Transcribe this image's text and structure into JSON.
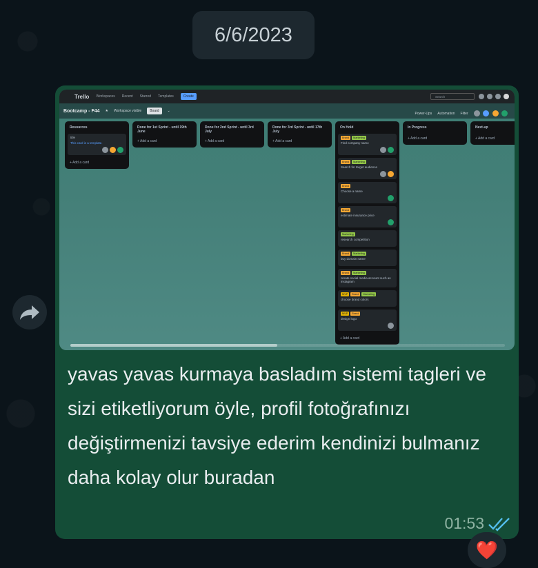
{
  "date_separator": "6/6/2023",
  "message": {
    "text": "yavas yavas kurmaya basladım sistemi tagleri ve sizi etiketliyorum öyle, profil fotoğrafınızı değiştirmenizi tavsiye ederim kendinizi bulmanız daha kolay olur buradan",
    "time": "01:53",
    "reaction": "❤️"
  },
  "trello": {
    "logo": "Trello",
    "menu": [
      "Workspaces",
      "Recent",
      "Starred",
      "Templates"
    ],
    "create": "Create",
    "search_placeholder": "Search",
    "board_name": "Bootcamp - F44",
    "visibility": "Workspace visible",
    "view": "Board",
    "tools": [
      "Power-Ups",
      "Automation",
      "Filter"
    ],
    "add_card": "+ Add a card",
    "lists": [
      {
        "title": "Resources",
        "cards": [
          {
            "title": "title",
            "sub": "This card is a template."
          }
        ]
      },
      {
        "title": "Done for 1st Sprint - until 19th June",
        "cards": []
      },
      {
        "title": "Done for 2nd Sprint - until 3rd July",
        "cards": []
      },
      {
        "title": "Done for 3rd Sprint - until 17th July",
        "cards": []
      },
      {
        "title": "On Hold",
        "cards": [
          {
            "labels": [
              "Brand",
              "Marketing"
            ],
            "title": "Find company name"
          },
          {
            "labels": [
              "Brand",
              "Marketing"
            ],
            "title": "Search for target audience"
          },
          {
            "labels": [
              "Brand"
            ],
            "title": "Choose a name"
          },
          {
            "labels": [
              "Brand"
            ],
            "title": "estimate insurance price"
          },
          {
            "labels": [
              "Marketing"
            ],
            "title": "research competition"
          },
          {
            "labels": [
              "Brand",
              "Marketing"
            ],
            "title": "buy domain name"
          },
          {
            "labels": [
              "Brand",
              "Marketing"
            ],
            "title": "create social media account such as instagram"
          },
          {
            "labels": [
              "MVP",
              "Brand",
              "Marketing"
            ],
            "title": "choose brand colors"
          },
          {
            "labels": [
              "MVP",
              "Brand"
            ],
            "title": "design logo"
          }
        ]
      },
      {
        "title": "In Progress",
        "cards": []
      },
      {
        "title": "Next-up",
        "cards": []
      }
    ]
  },
  "colors": {
    "bubble": "#144d37",
    "background": "#0b141a",
    "read_ticks": "#53bdeb"
  }
}
